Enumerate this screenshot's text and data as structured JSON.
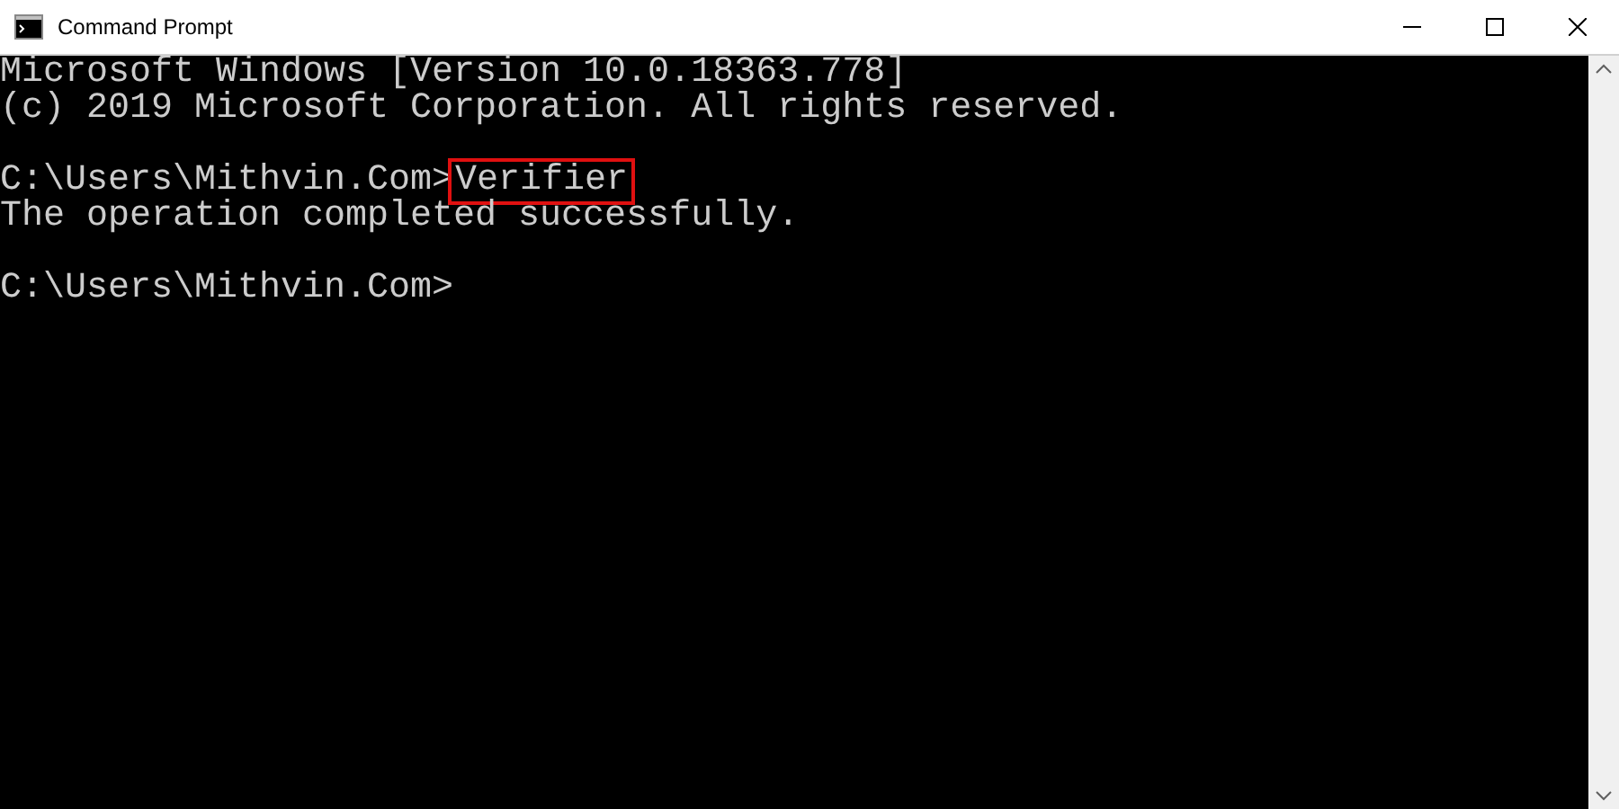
{
  "window": {
    "title": "Command Prompt"
  },
  "console": {
    "lines": [
      {
        "kind": "output",
        "text": "Microsoft Windows [Version 10.0.18363.778]"
      },
      {
        "kind": "output",
        "text": "(c) 2019 Microsoft Corporation. All rights reserved."
      },
      {
        "kind": "blank"
      },
      {
        "kind": "command",
        "prompt": "C:\\Users\\Mithvin.Com>",
        "command": "Verifier",
        "highlighted": true
      },
      {
        "kind": "output",
        "text": "The operation completed successfully."
      },
      {
        "kind": "blank"
      },
      {
        "kind": "command",
        "prompt": "C:\\Users\\Mithvin.Com>"
      }
    ]
  }
}
